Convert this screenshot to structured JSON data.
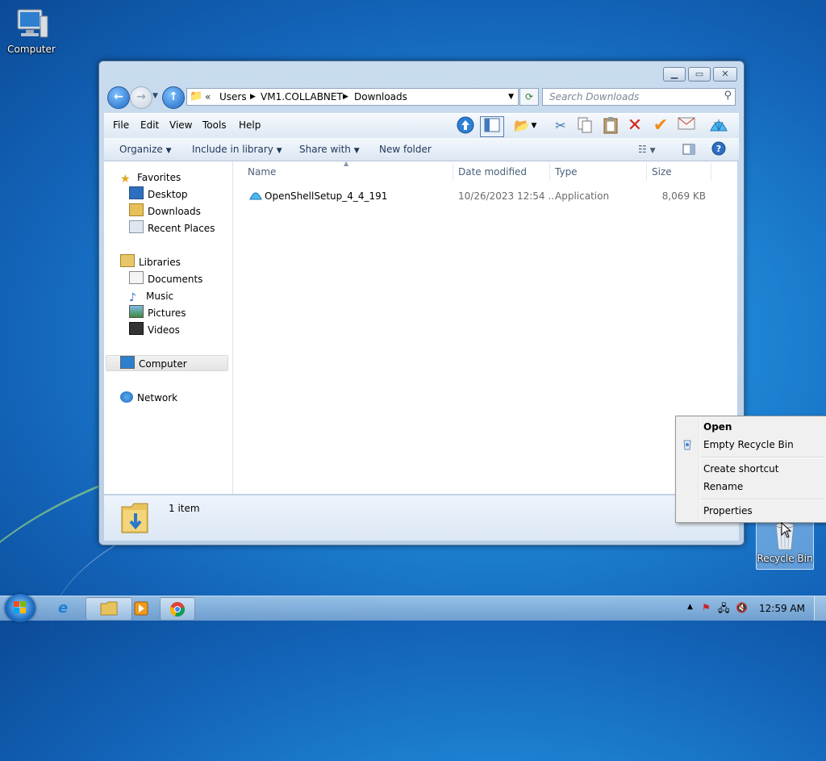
{
  "desktop": {
    "computer_label": "Computer",
    "recycle_bin_label": "Recycle Bin"
  },
  "window": {
    "address": {
      "overflow": "«",
      "crumbs": [
        "Users",
        "VM1.COLLABNET",
        "Downloads"
      ]
    },
    "search_placeholder": "Search Downloads",
    "menu": [
      "File",
      "Edit",
      "View",
      "Tools",
      "Help"
    ],
    "commands": {
      "organize": "Organize",
      "include_in_library": "Include in library",
      "share_with": "Share with",
      "new_folder": "New folder"
    },
    "nav": {
      "favorites": "Favorites",
      "desktop": "Desktop",
      "downloads": "Downloads",
      "recent_places": "Recent Places",
      "libraries": "Libraries",
      "documents": "Documents",
      "music": "Music",
      "pictures": "Pictures",
      "videos": "Videos",
      "computer": "Computer",
      "network": "Network"
    },
    "columns": [
      "Name",
      "Date modified",
      "Type",
      "Size"
    ],
    "files": [
      {
        "name": "OpenShellSetup_4_4_191",
        "date": "10/26/2023 12:54 ...",
        "type": "Application",
        "size": "8,069 KB"
      }
    ],
    "status": "1 item"
  },
  "context_menu": {
    "open": "Open",
    "empty": "Empty Recycle Bin",
    "create_shortcut": "Create shortcut",
    "rename": "Rename",
    "properties": "Properties"
  },
  "taskbar": {
    "clock": "12:59 AM"
  }
}
